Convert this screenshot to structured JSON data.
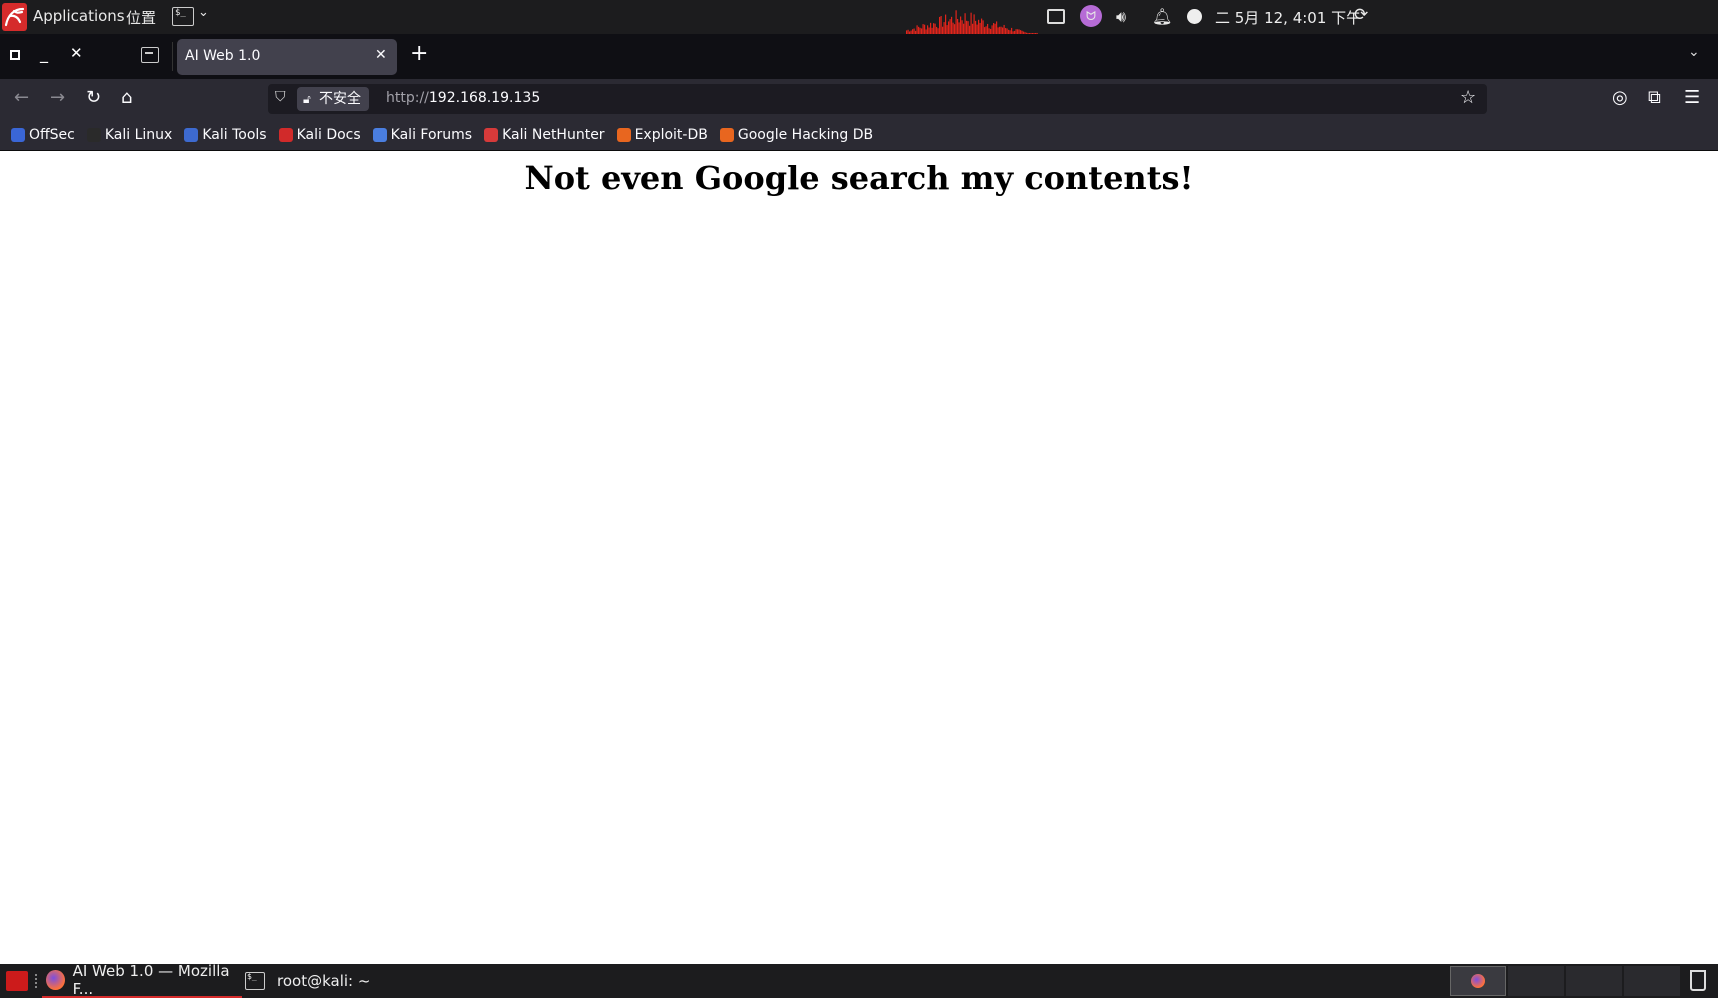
{
  "panel": {
    "apps_label": "Applications",
    "places_label": "位置",
    "clock": "二 5月 12,  4:01 下午",
    "cpu_graph_color": "#e0241b"
  },
  "browser": {
    "tab_title": "AI Web 1.0",
    "url_scheme": "http://",
    "url_host": "192.168.19.135",
    "insecure_label": "不安全"
  },
  "bookmarks": [
    {
      "label": "OffSec",
      "color": "#3a66d6"
    },
    {
      "label": "Kali Linux",
      "color": "#2a2a2a"
    },
    {
      "label": "Kali Tools",
      "color": "#3d6ad0"
    },
    {
      "label": "Kali Docs",
      "color": "#d12a2a"
    },
    {
      "label": "Kali Forums",
      "color": "#4a7ee0"
    },
    {
      "label": "Kali NetHunter",
      "color": "#d63a3a"
    },
    {
      "label": "Exploit-DB",
      "color": "#e8661f"
    },
    {
      "label": "Google Hacking DB",
      "color": "#e8661f"
    }
  ],
  "page": {
    "heading": "Not even Google search my contents!"
  },
  "taskbar": {
    "firefox_task": "AI Web 1.0 — Mozilla F...",
    "terminal_task": "root@kali: ~"
  }
}
